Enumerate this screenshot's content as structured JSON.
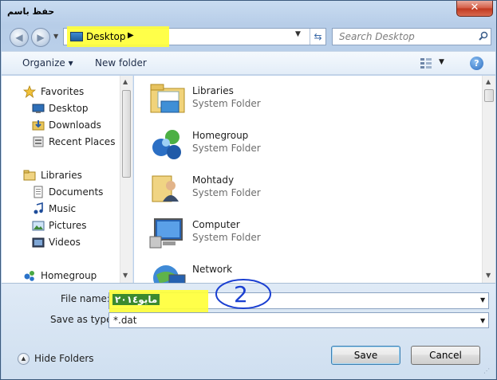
{
  "window": {
    "title": "حفظ باسم",
    "close_label": "✕"
  },
  "nav": {
    "back_icon": "back-arrow-icon",
    "forward_icon": "forward-arrow-icon"
  },
  "address": {
    "location": "Desktop",
    "separator": "▶"
  },
  "search": {
    "placeholder": "Search Desktop"
  },
  "toolbar": {
    "organize_label": "Organize ▾",
    "new_folder_label": "New folder",
    "help_label": "?"
  },
  "sidebar": {
    "items": [
      {
        "label": "Favorites",
        "icon": "star-icon",
        "group": true
      },
      {
        "label": "Desktop",
        "icon": "desktop-icon"
      },
      {
        "label": "Downloads",
        "icon": "downloads-icon"
      },
      {
        "label": "Recent Places",
        "icon": "recent-places-icon"
      },
      {
        "label": "Libraries",
        "icon": "libraries-icon",
        "group": true
      },
      {
        "label": "Documents",
        "icon": "documents-icon"
      },
      {
        "label": "Music",
        "icon": "music-icon"
      },
      {
        "label": "Pictures",
        "icon": "pictures-icon"
      },
      {
        "label": "Videos",
        "icon": "videos-icon"
      },
      {
        "label": "Homegroup",
        "icon": "homegroup-icon",
        "group": true
      }
    ]
  },
  "content": {
    "items": [
      {
        "name": "Libraries",
        "type": "System Folder",
        "icon": "libraries-folder-icon"
      },
      {
        "name": "Homegroup",
        "type": "System Folder",
        "icon": "homegroup-icon"
      },
      {
        "name": "Mohtady",
        "type": "System Folder",
        "icon": "user-folder-icon"
      },
      {
        "name": "Computer",
        "type": "System Folder",
        "icon": "computer-icon"
      },
      {
        "name": "Network",
        "type": "",
        "icon": "network-icon"
      }
    ]
  },
  "form": {
    "file_name_label": "File name:",
    "file_name_value": "مايو٢٠١٤",
    "save_as_type_label": "Save as type:",
    "save_as_type_value": "*.dat"
  },
  "footer": {
    "hide_folders_label": "Hide Folders",
    "save_label": "Save",
    "cancel_label": "Cancel"
  },
  "annotation": {
    "text": "2",
    "color": "#1a3fd1",
    "highlight_color": "#ffff3a"
  }
}
